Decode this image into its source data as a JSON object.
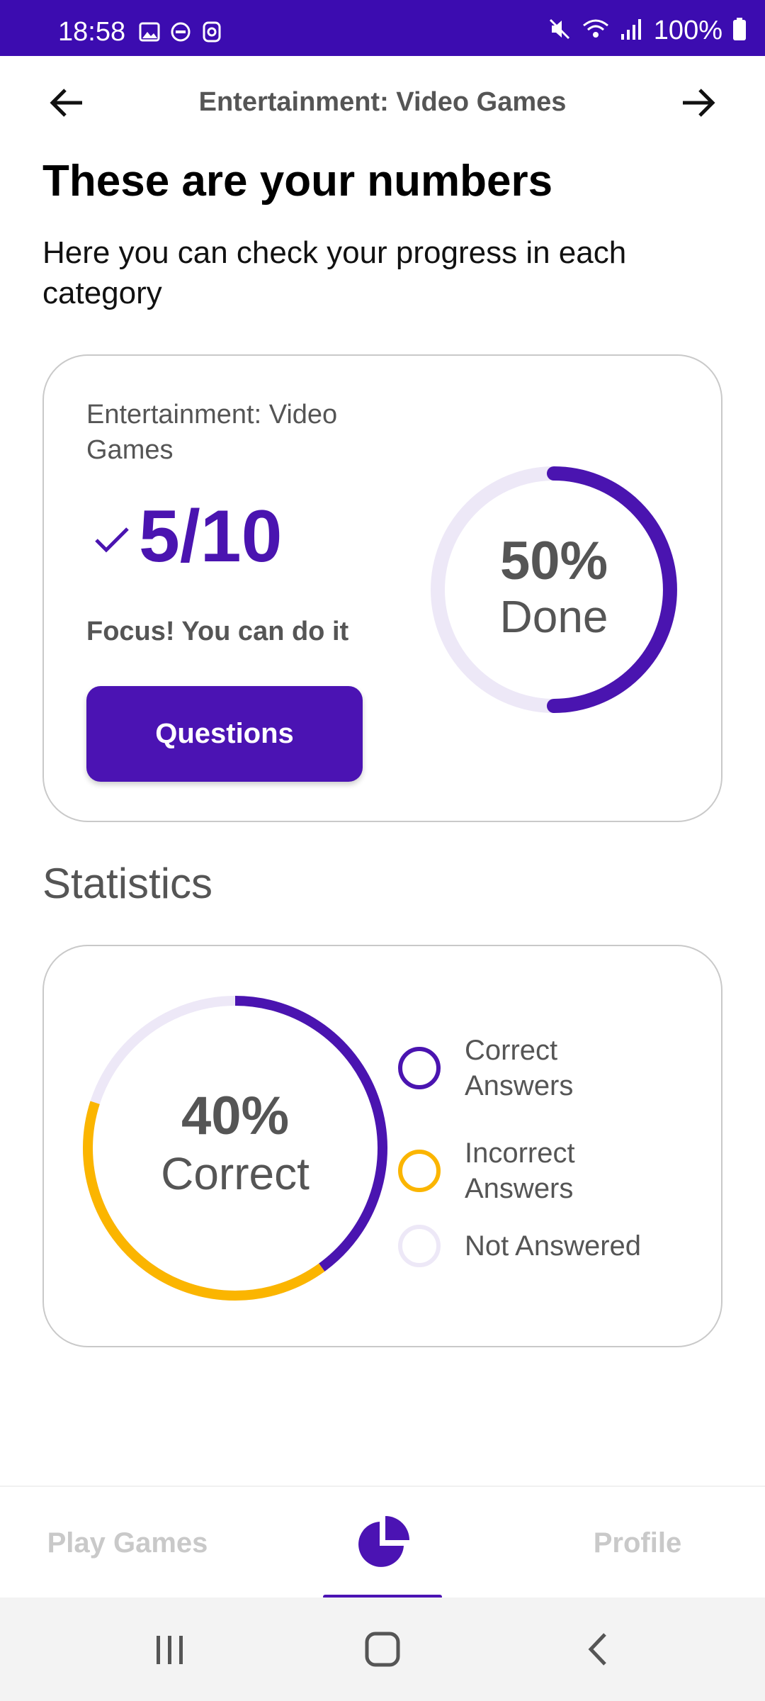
{
  "status_bar": {
    "time": "18:58",
    "battery": "100%",
    "icons_left": [
      "image-icon",
      "do-not-disturb-icon",
      "sync-icon"
    ],
    "icons_right": [
      "mute-icon",
      "wifi-icon",
      "signal-icon",
      "battery-icon"
    ]
  },
  "top_bar": {
    "title": "Entertainment: Video Games"
  },
  "headline": "These are your numbers",
  "subtitle": "Here you can check your progress in each category",
  "progress_card": {
    "category": "Entertainment: Video Games",
    "score": "5/10",
    "motivation": "Focus! You can do it",
    "button_label": "Questions",
    "donut_percent": "50%",
    "donut_word": "Done",
    "progress_fraction": 0.5
  },
  "statistics": {
    "title": "Statistics",
    "donut_percent": "40%",
    "donut_word": "Correct",
    "legend": [
      {
        "label": "Correct Answers",
        "color": "#4a14b0"
      },
      {
        "label": "Incorrect Answers",
        "color": "#fbb500"
      },
      {
        "label": "Not Answered",
        "color": "#ede8f7"
      }
    ]
  },
  "chart_data": {
    "type": "pie",
    "categories": [
      "Correct Answers",
      "Incorrect Answers",
      "Not Answered"
    ],
    "values": [
      4,
      4,
      2
    ],
    "colors": [
      "#4a14b0",
      "#fbb500",
      "#ede8f7"
    ]
  },
  "bottom_nav": {
    "items": [
      {
        "label": "Play Games"
      },
      {
        "label": ""
      },
      {
        "label": "Profile"
      }
    ],
    "active_index": 1
  },
  "colors": {
    "primary": "#4b13b3",
    "status_bar": "#3c0cb0",
    "accent_yellow": "#fbb500",
    "track": "#ede8f7"
  }
}
